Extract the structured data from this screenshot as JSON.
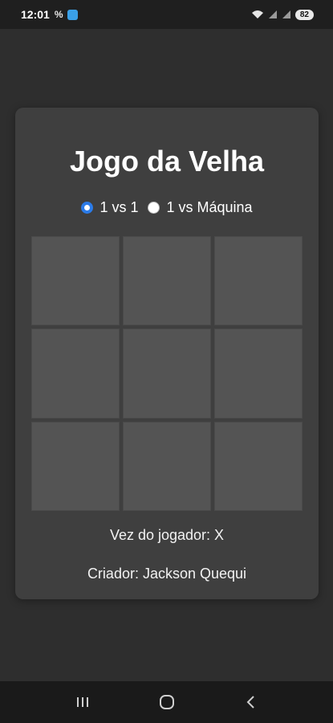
{
  "status_bar": {
    "time": "12:01",
    "signal_label": "%",
    "battery": "82"
  },
  "game": {
    "title": "Jogo da Velha",
    "modes": [
      {
        "label": "1 vs 1",
        "selected": true
      },
      {
        "label": "1 vs Máquina",
        "selected": false
      }
    ],
    "board": [
      "",
      "",
      "",
      "",
      "",
      "",
      "",
      "",
      ""
    ],
    "turn_text": "Vez do jogador: X",
    "creator_text": "Criador: Jackson Quequi"
  },
  "nav": {
    "icons": [
      "recent-apps-icon",
      "home-icon",
      "back-icon"
    ]
  },
  "colors": {
    "background": "#2e2e2e",
    "card": "#3f3f3f",
    "cell": "#545454",
    "radio_accent": "#2b7be8"
  }
}
